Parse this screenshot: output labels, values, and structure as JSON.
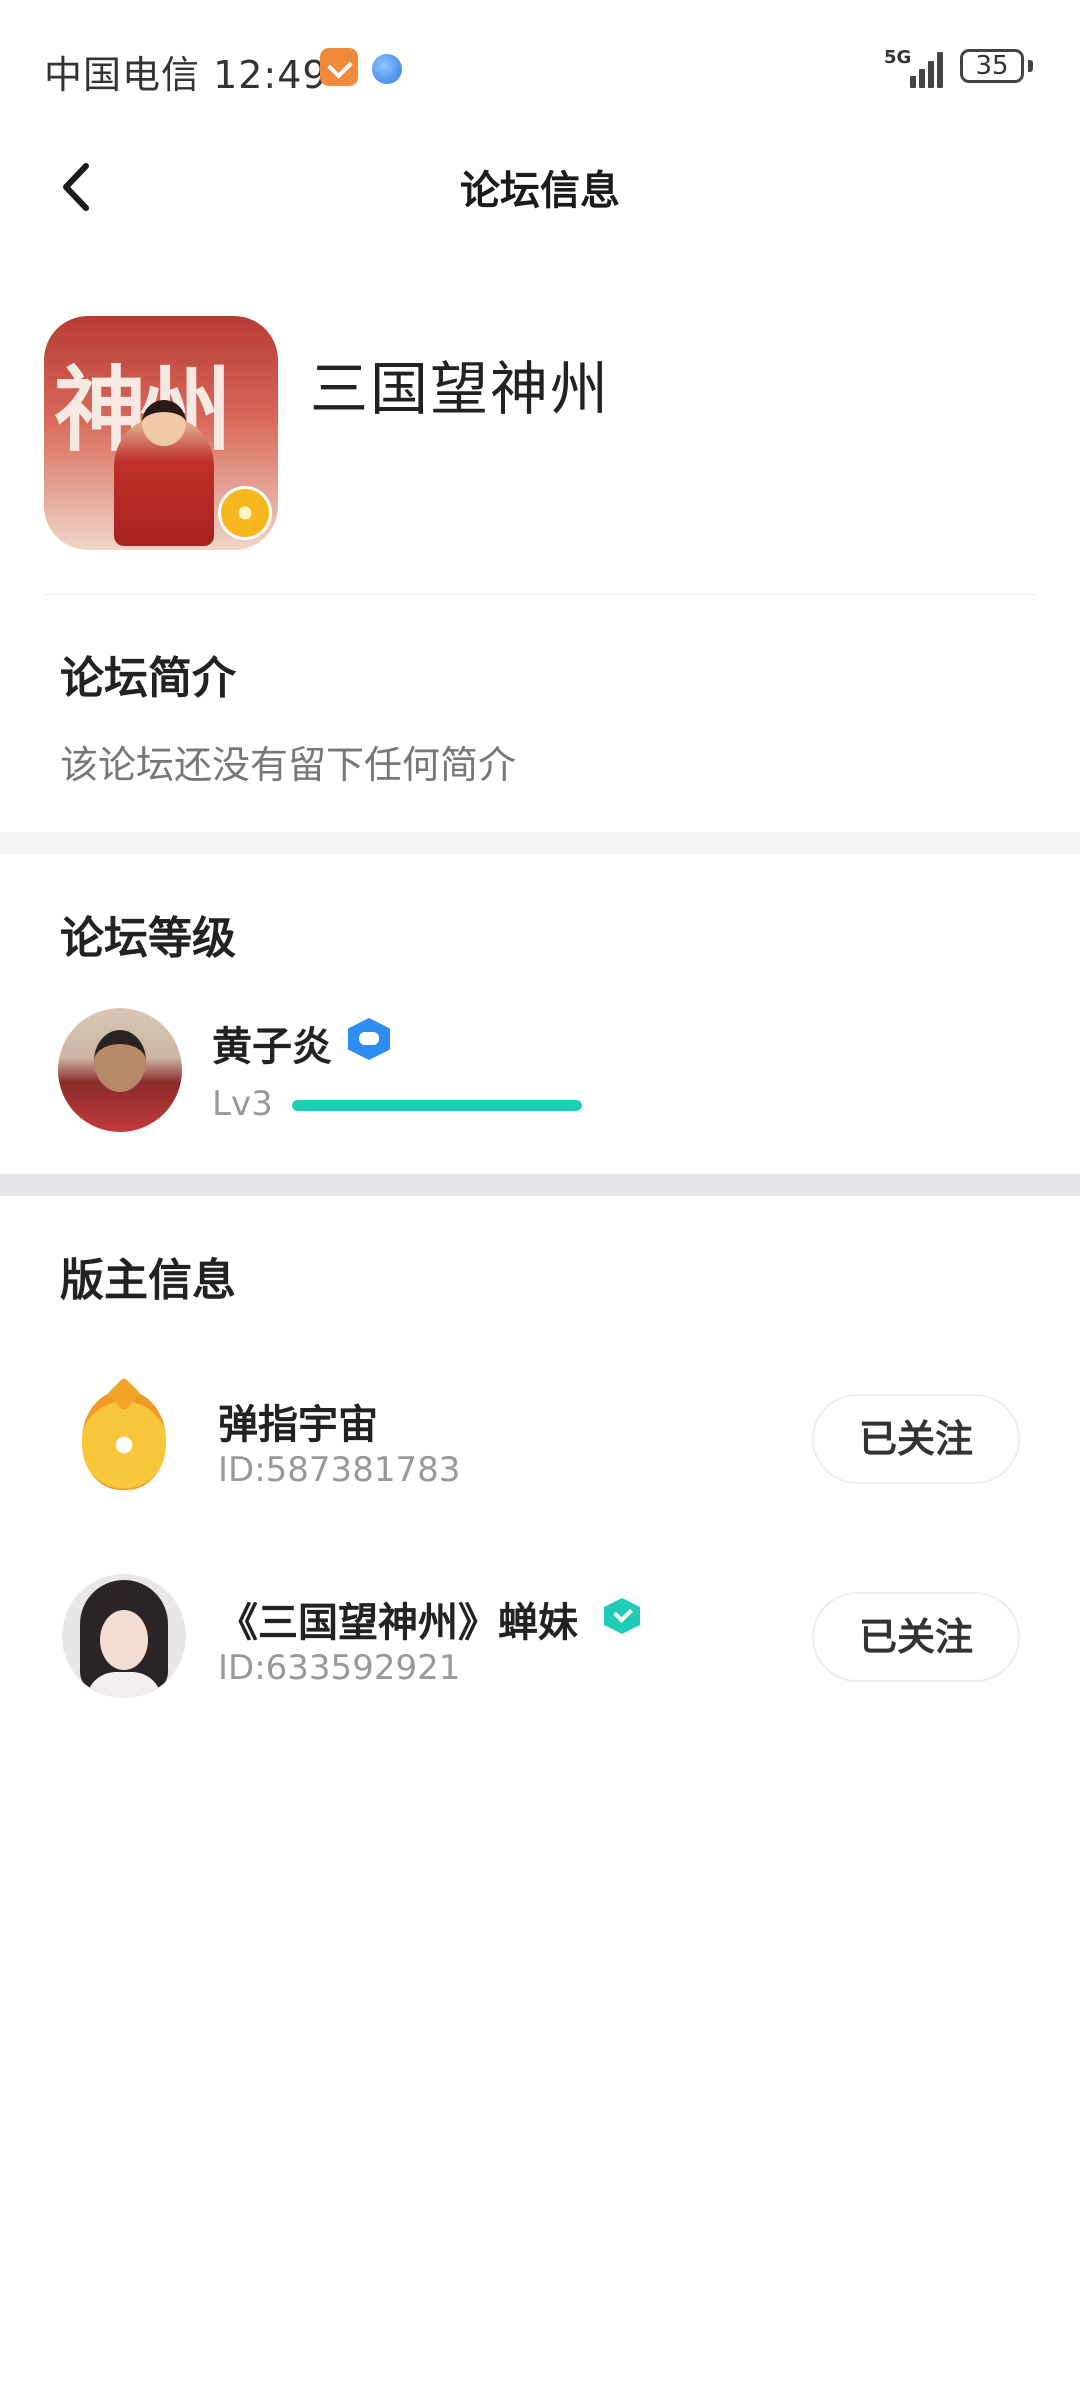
{
  "status_bar": {
    "carrier_time": "中国电信 12:49",
    "network": "5G",
    "battery": "35"
  },
  "nav": {
    "title": "论坛信息"
  },
  "forum": {
    "logo_text": "神州",
    "name": "三国望神州"
  },
  "intro": {
    "title": "论坛简介",
    "text": "该论坛还没有留下任何简介"
  },
  "level": {
    "title": "论坛等级",
    "user_name": "黄子炎",
    "level_label": "Lv3",
    "progress": 1.0
  },
  "moderators": {
    "title": "版主信息",
    "items": [
      {
        "name": "弹指宇宙",
        "id": "ID:587381783",
        "follow_label": "已关注",
        "verified": false
      },
      {
        "name": "《三国望神州》蝉妹",
        "id": "ID:633592921",
        "follow_label": "已关注",
        "verified": true
      }
    ]
  },
  "colors": {
    "accent": "#1fcdb6",
    "badge_blue": "#2d8df0",
    "section_band": "#f3f4f6"
  }
}
